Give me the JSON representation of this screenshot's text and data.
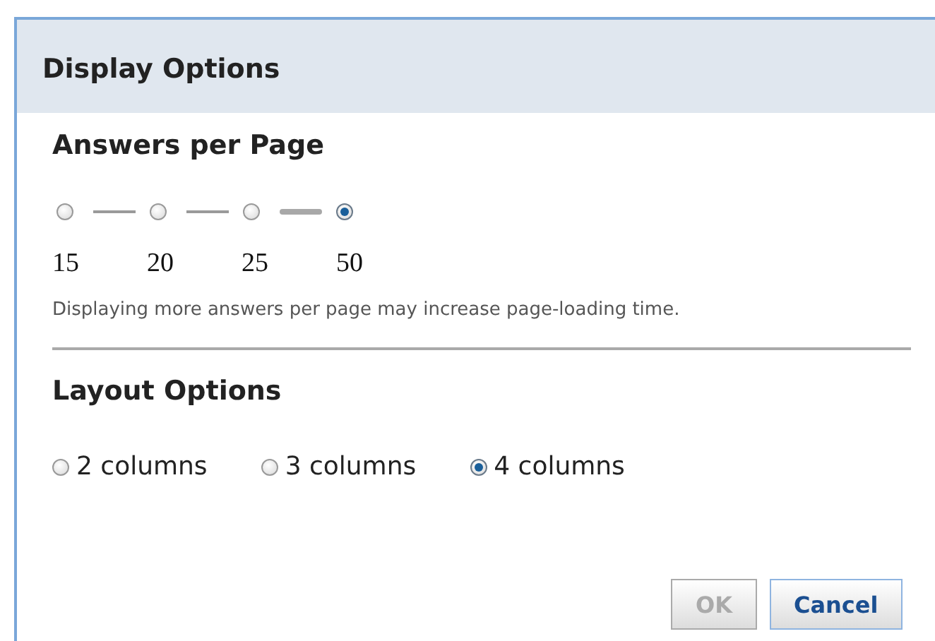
{
  "dialog": {
    "title": "Display Options"
  },
  "answers_per_page": {
    "heading": "Answers per Page",
    "options": [
      {
        "label": "15",
        "selected": false
      },
      {
        "label": "20",
        "selected": false
      },
      {
        "label": "25",
        "selected": false
      },
      {
        "label": "50",
        "selected": true
      }
    ],
    "hint": "Displaying more answers per page may increase page-loading time."
  },
  "layout_options": {
    "heading": "Layout Options",
    "options": [
      {
        "label": "2 columns",
        "selected": false
      },
      {
        "label": "3 columns",
        "selected": false
      },
      {
        "label": "4 columns",
        "selected": true
      }
    ]
  },
  "buttons": [
    {
      "label": "OK",
      "disabled": true
    },
    {
      "label": "Cancel",
      "disabled": false
    }
  ]
}
